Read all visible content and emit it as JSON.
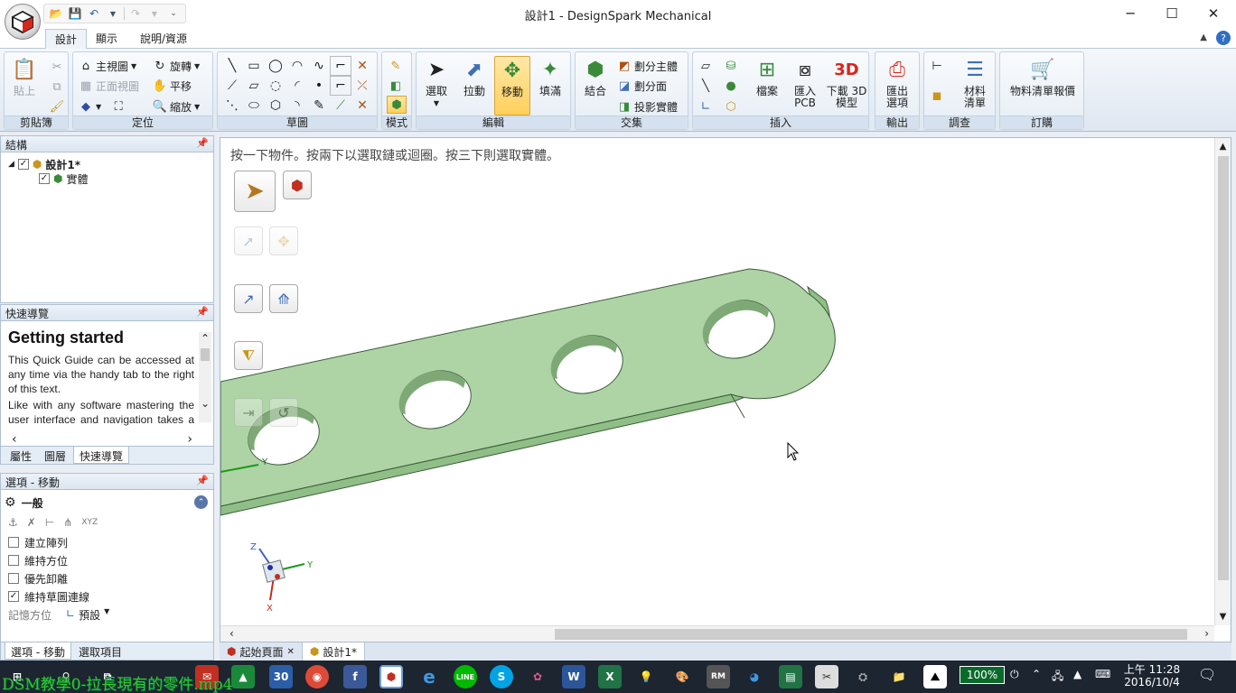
{
  "window": {
    "title": "設計1 - DesignSpark Mechanical",
    "minimize_glyph": "─",
    "maximize_glyph": "☐",
    "close_glyph": "✕"
  },
  "ribbon_tabs": [
    {
      "label": "設計",
      "active": true
    },
    {
      "label": "顯示",
      "active": false
    },
    {
      "label": "說明/資源",
      "active": false
    }
  ],
  "ribbon": {
    "clipboard": {
      "paste": "貼上",
      "label": "剪貼簿"
    },
    "orient": {
      "home_view": "主視圖",
      "front_view": "正面視圖",
      "rotate": "旋轉",
      "pan": "平移",
      "zoom": "縮放",
      "label": "定位"
    },
    "sketch": {
      "label": "草圖"
    },
    "mode": {
      "label": "模式"
    },
    "edit": {
      "select": "選取",
      "pull": "拉動",
      "move": "移動",
      "fill": "填滿",
      "label": "編輯"
    },
    "intersect": {
      "combine": "結合",
      "split_body": "劃分主體",
      "split_face": "劃分面",
      "project": "投影實體",
      "label": "交集"
    },
    "insert": {
      "file": "檔案",
      "import_pcb_1": "匯入",
      "import_pcb_2": "PCB",
      "download_3d_1": "下載 3D",
      "download_3d_2": "模型",
      "label": "插入"
    },
    "output": {
      "export_1": "匯出",
      "export_2": "選項",
      "label": "輸出"
    },
    "investigate": {
      "bom_1": "材料",
      "bom_2": "清單",
      "label": "調查"
    },
    "order": {
      "bom_quote": "物料清單報價",
      "label": "訂購"
    }
  },
  "structure_panel": {
    "title": "結構",
    "items": [
      {
        "label": "設計1*",
        "checked": true
      },
      {
        "label": "實體",
        "checked": true
      }
    ]
  },
  "quick_guide": {
    "title": "快速導覽",
    "heading": "Getting started",
    "paragraphs": [
      "This Quick Guide can be accessed at any time via the handy tab to the right of this text.",
      "Like with any software mastering the user interface and navigation takes a bit of practice. Please select a topic of"
    ],
    "tabs": [
      "屬性",
      "圖層",
      "快速導覽"
    ]
  },
  "options_panel": {
    "title": "選項 - 移動",
    "section": "一般",
    "checkboxes": [
      {
        "label": "建立陣列",
        "checked": false
      },
      {
        "label": "維持方位",
        "checked": false
      },
      {
        "label": "優先卸離",
        "checked": false
      },
      {
        "label": "維持草圖連線",
        "checked": true
      }
    ],
    "memory_label": "記憶方位",
    "memory_value": "預設",
    "tabs": [
      "選項 - 移動",
      "選取項目"
    ]
  },
  "viewport": {
    "hint": "按一下物件。按兩下以選取鏈或迴圈。按三下則選取實體。",
    "part_color": "#aed4a6",
    "part_edge_color": "#3c5a3a",
    "axis_labels": {
      "x": "X",
      "y": "Y",
      "z": "Z"
    }
  },
  "doc_tabs": [
    {
      "label": "起始頁面",
      "active": false
    },
    {
      "label": "設計1*",
      "active": true
    }
  ],
  "taskbar": {
    "battery": "100%",
    "time_period": "上午 11:28",
    "date": "2016/10/4",
    "calendar_day": "30"
  },
  "video_caption": "DSM教學0-拉長現有的零件.mp4"
}
